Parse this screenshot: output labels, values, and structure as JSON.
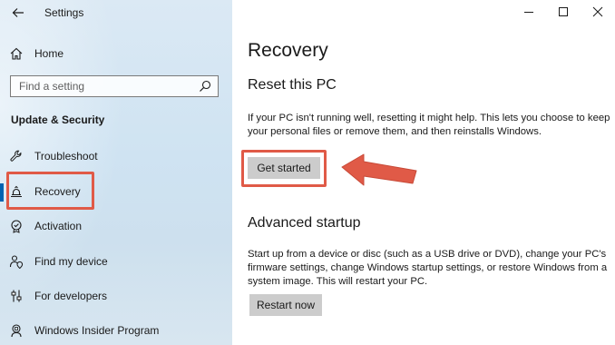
{
  "window": {
    "title": "Settings"
  },
  "sidebar": {
    "home_label": "Home",
    "search_placeholder": "Find a setting",
    "section_heading": "Update & Security",
    "items": [
      {
        "label": "Troubleshoot",
        "icon": "wrench-icon"
      },
      {
        "label": "Recovery",
        "icon": "recovery-icon",
        "selected": true
      },
      {
        "label": "Activation",
        "icon": "activation-icon"
      },
      {
        "label": "Find my device",
        "icon": "person-location-icon"
      },
      {
        "label": "For developers",
        "icon": "developer-sliders-icon"
      },
      {
        "label": "Windows Insider Program",
        "icon": "insider-icon"
      }
    ]
  },
  "main": {
    "title": "Recovery",
    "reset": {
      "heading": "Reset this PC",
      "description": "If your PC isn't running well, resetting it might help. This lets you choose to keep your personal files or remove them, and then reinstalls Windows.",
      "button_label": "Get started"
    },
    "advanced": {
      "heading": "Advanced startup",
      "description": "Start up from a device or disc (such as a USB drive or DVD), change your PC's firmware settings, change Windows startup settings, or restore Windows from a system image. This will restart your PC.",
      "button_label": "Restart now"
    }
  },
  "colors": {
    "accent": "#0063b1",
    "annotation": "#e05a47",
    "button": "#cccccc"
  }
}
